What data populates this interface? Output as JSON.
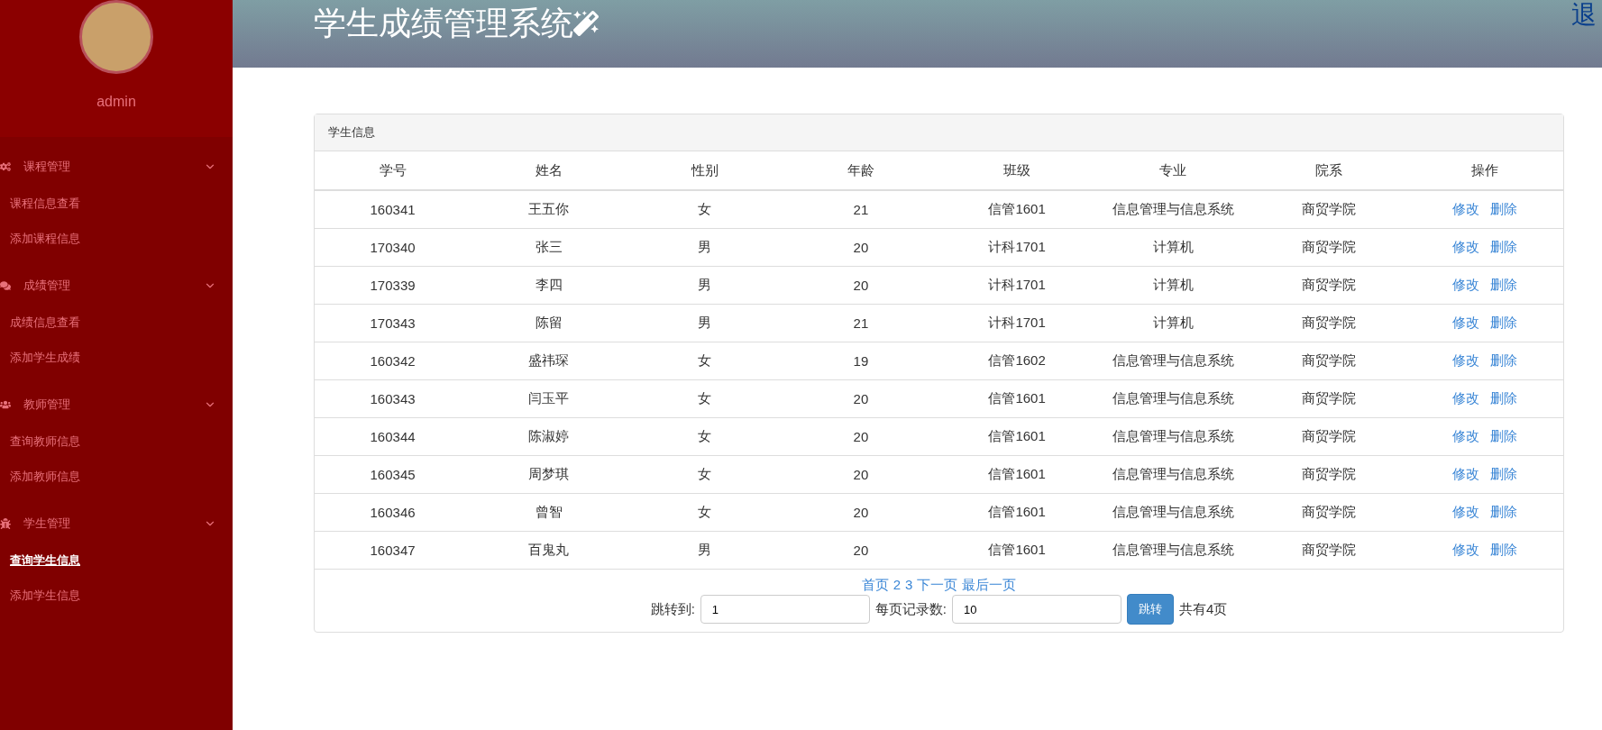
{
  "sidebar": {
    "user": "admin",
    "groups": [
      {
        "title": "课程管理",
        "expanded": true,
        "items": [
          {
            "label": "课程信息查看",
            "selected": false
          },
          {
            "label": "添加课程信息",
            "selected": false
          }
        ]
      },
      {
        "title": "成绩管理",
        "expanded": true,
        "items": [
          {
            "label": "成绩信息查看",
            "selected": false
          },
          {
            "label": "添加学生成绩",
            "selected": false
          }
        ]
      },
      {
        "title": "教师管理",
        "expanded": true,
        "items": [
          {
            "label": "查询教师信息",
            "selected": false
          },
          {
            "label": "添加教师信息",
            "selected": false
          }
        ]
      },
      {
        "title": "学生管理",
        "expanded": true,
        "items": [
          {
            "label": "查询学生信息",
            "selected": true
          },
          {
            "label": "添加学生信息",
            "selected": false
          }
        ]
      }
    ]
  },
  "header": {
    "title": "学生成绩管理系统",
    "corner_text": "退"
  },
  "panel": {
    "title": "学生信息",
    "table": {
      "columns": [
        "学号",
        "姓名",
        "性别",
        "年龄",
        "班级",
        "专业",
        "院系",
        "操作"
      ],
      "rows": [
        {
          "cells": [
            "160341",
            "王五你",
            "女",
            "21",
            "信管1601",
            "信息管理与信息系统",
            "商贸学院"
          ],
          "actions": [
            "修改",
            "删除"
          ]
        },
        {
          "cells": [
            "170340",
            "张三",
            "男",
            "20",
            "计科1701",
            "计算机",
            "商贸学院"
          ],
          "actions": [
            "修改",
            "删除"
          ]
        },
        {
          "cells": [
            "170339",
            "李四",
            "男",
            "20",
            "计科1701",
            "计算机",
            "商贸学院"
          ],
          "actions": [
            "修改",
            "删除"
          ]
        },
        {
          "cells": [
            "170343",
            "陈留",
            "男",
            "21",
            "计科1701",
            "计算机",
            "商贸学院"
          ],
          "actions": [
            "修改",
            "删除"
          ]
        },
        {
          "cells": [
            "160342",
            "盛祎琛",
            "女",
            "19",
            "信管1602",
            "信息管理与信息系统",
            "商贸学院"
          ],
          "actions": [
            "修改",
            "删除"
          ]
        },
        {
          "cells": [
            "160343",
            "闫玉平",
            "女",
            "20",
            "信管1601",
            "信息管理与信息系统",
            "商贸学院"
          ],
          "actions": [
            "修改",
            "删除"
          ]
        },
        {
          "cells": [
            "160344",
            "陈淑婷",
            "女",
            "20",
            "信管1601",
            "信息管理与信息系统",
            "商贸学院"
          ],
          "actions": [
            "修改",
            "删除"
          ]
        },
        {
          "cells": [
            "160345",
            "周梦琪",
            "女",
            "20",
            "信管1601",
            "信息管理与信息系统",
            "商贸学院"
          ],
          "actions": [
            "修改",
            "删除"
          ]
        },
        {
          "cells": [
            "160346",
            "曾智",
            "女",
            "20",
            "信管1601",
            "信息管理与信息系统",
            "商贸学院"
          ],
          "actions": [
            "修改",
            "删除"
          ]
        },
        {
          "cells": [
            "160347",
            "百鬼丸",
            "男",
            "20",
            "信管1601",
            "信息管理与信息系统",
            "商贸学院"
          ],
          "actions": [
            "修改",
            "删除"
          ]
        }
      ]
    },
    "pagination": {
      "links": [
        "首页",
        "2",
        "3",
        "下一页",
        "最后一页"
      ],
      "jump_label": "跳转到:",
      "jump_value": "1",
      "size_label": "每页记录数:",
      "size_value": "10",
      "button": "跳转",
      "total": "共有4页"
    }
  }
}
